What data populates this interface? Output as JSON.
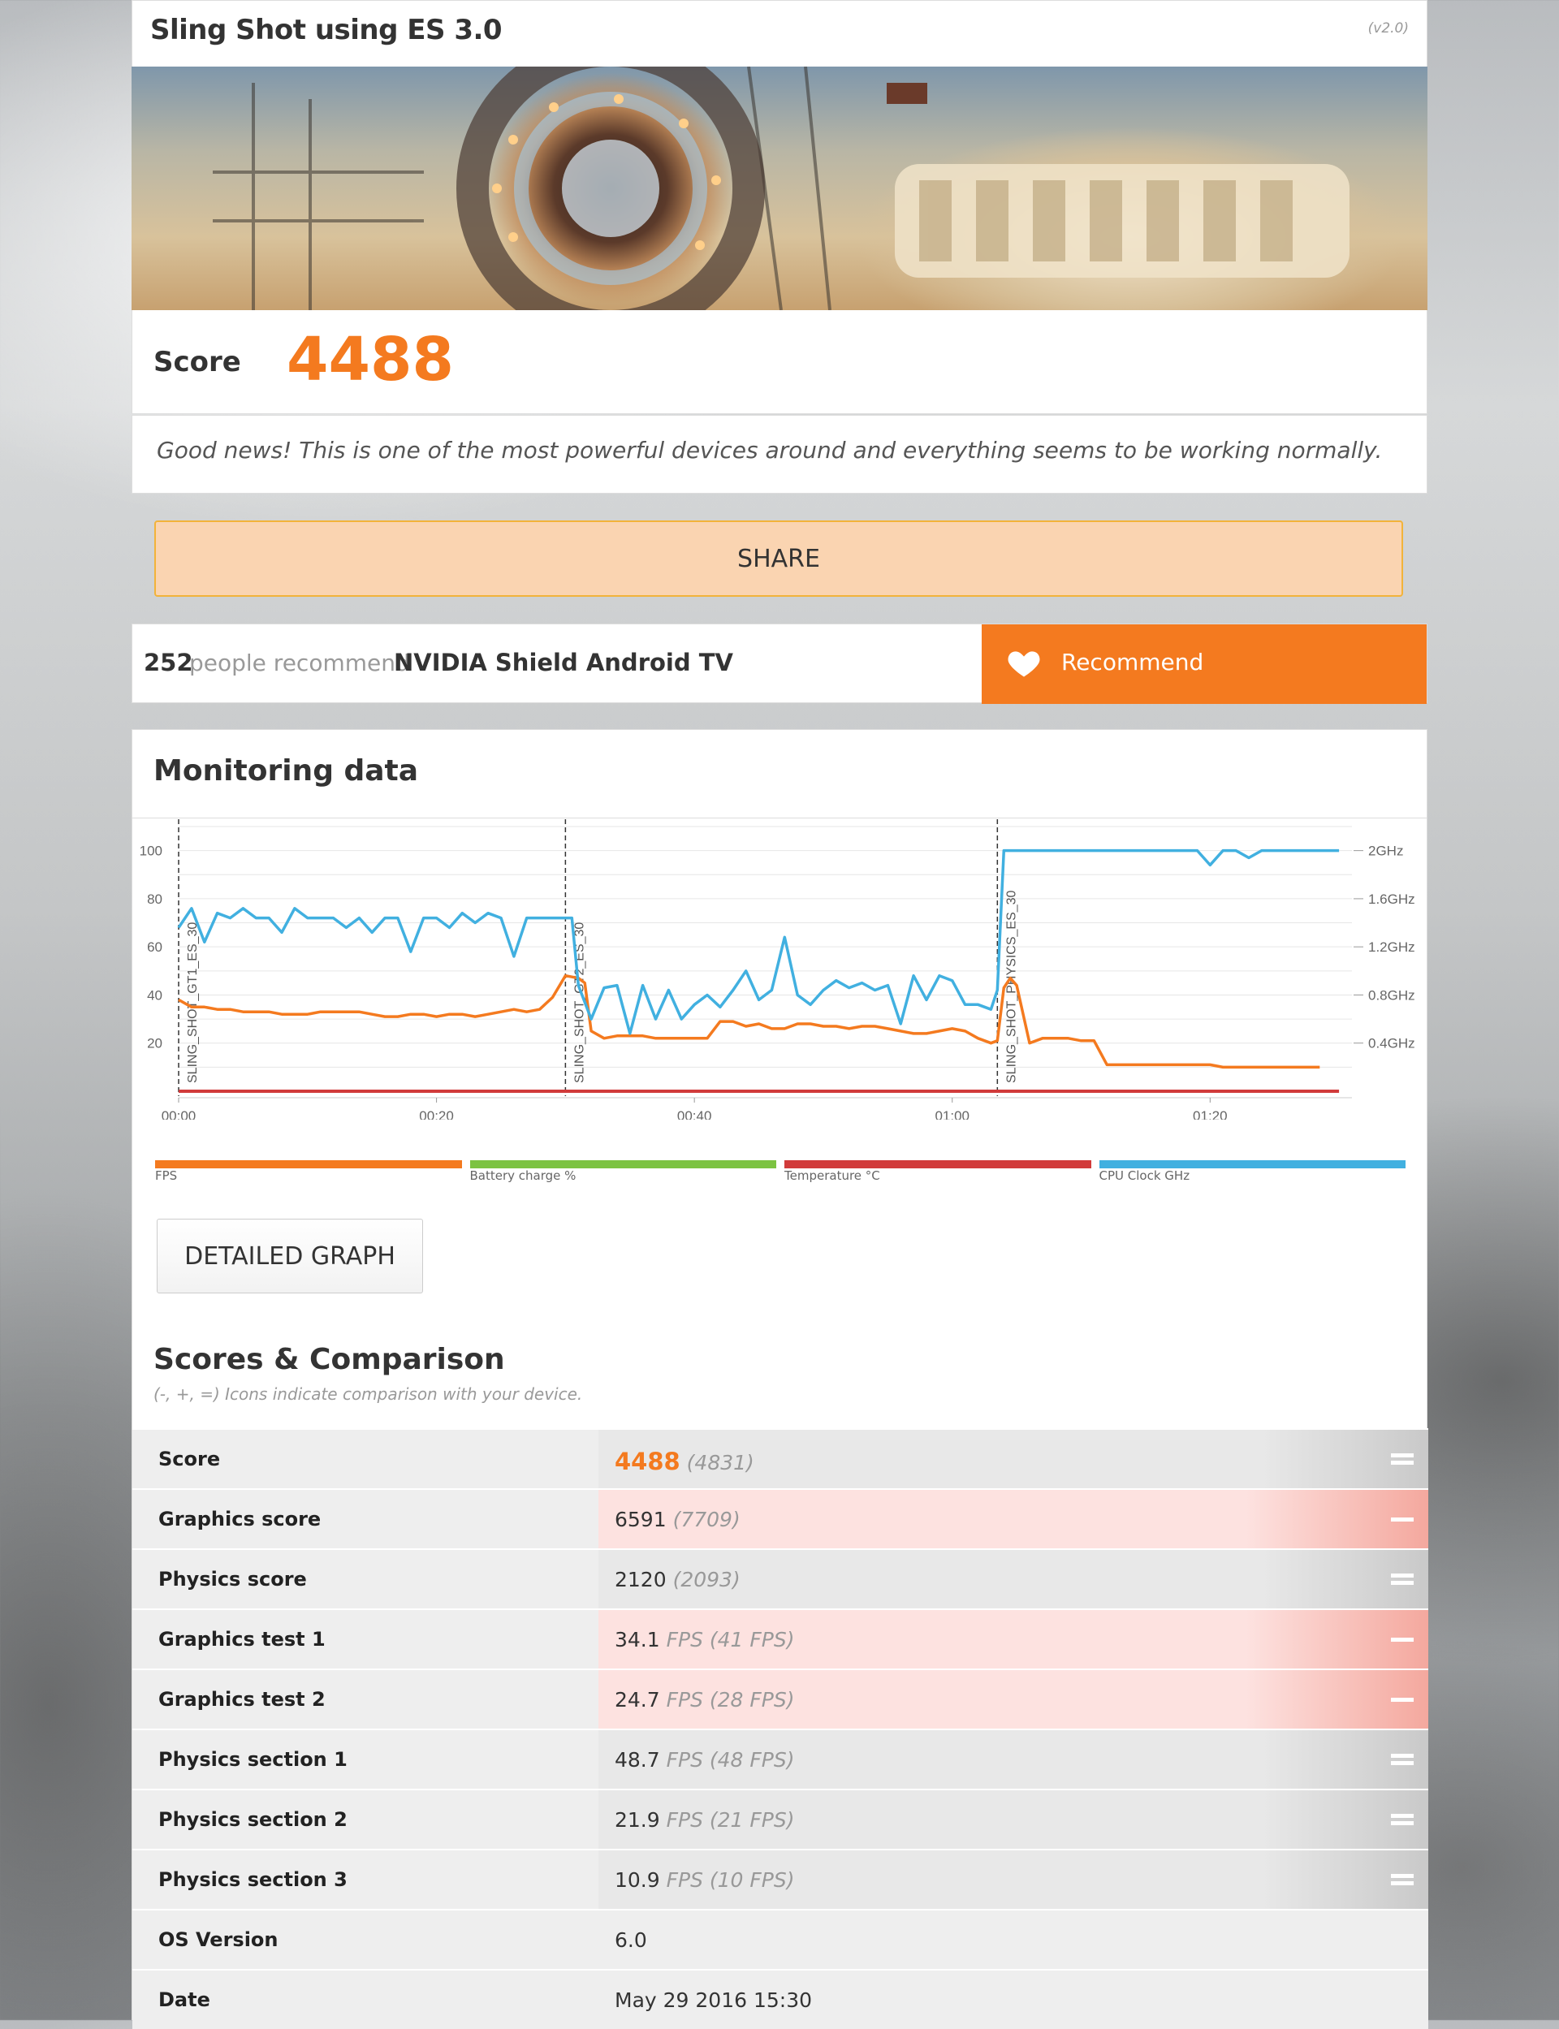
{
  "header": {
    "title": "Sling Shot using ES 3.0",
    "version": "(v2.0)"
  },
  "score": {
    "label": "Score",
    "value": "4488"
  },
  "message": "Good news! This is one of the most powerful devices around and everything seems to be working normally.",
  "share_label": "SHARE",
  "recommend": {
    "count": "252",
    "text": "people recommend",
    "device": "NVIDIA Shield Android TV",
    "button_label": "Recommend"
  },
  "monitoring": {
    "title": "Monitoring data",
    "detail_button": "DETAILED GRAPH"
  },
  "chart_data": {
    "type": "line",
    "x_ticks": [
      "00:00",
      "00:20",
      "00:40",
      "01:00",
      "01:20"
    ],
    "y_left_ticks": [
      "100",
      "80",
      "60",
      "40",
      "20"
    ],
    "y_right_ticks": [
      "2GHz",
      "1.6GHz",
      "1.2GHz",
      "0.8GHz",
      "0.4GHz"
    ],
    "ylim": [
      0,
      110
    ],
    "xlim_seconds": [
      0,
      91
    ],
    "markers": [
      {
        "label": "SLING_SHOT_GT1_ES_30",
        "t": 0
      },
      {
        "label": "SLING_SHOT_GT2_ES_30",
        "t": 30
      },
      {
        "label": "SLING_SHOT_PHYSICS_ES_30",
        "t": 63.5
      }
    ],
    "series": [
      {
        "name": "FPS",
        "color": "#f47a1f",
        "points": [
          [
            0,
            38
          ],
          [
            1,
            35
          ],
          [
            2,
            35
          ],
          [
            3,
            34
          ],
          [
            4,
            34
          ],
          [
            5,
            33
          ],
          [
            6,
            33
          ],
          [
            7,
            33
          ],
          [
            8,
            32
          ],
          [
            9,
            32
          ],
          [
            10,
            32
          ],
          [
            11,
            33
          ],
          [
            12,
            33
          ],
          [
            13,
            33
          ],
          [
            14,
            33
          ],
          [
            15,
            32
          ],
          [
            16,
            31
          ],
          [
            17,
            31
          ],
          [
            18,
            32
          ],
          [
            19,
            32
          ],
          [
            20,
            31
          ],
          [
            21,
            32
          ],
          [
            22,
            32
          ],
          [
            23,
            31
          ],
          [
            24,
            32
          ],
          [
            25,
            33
          ],
          [
            26,
            34
          ],
          [
            27,
            33
          ],
          [
            28,
            34
          ],
          [
            29,
            39
          ],
          [
            30,
            48
          ],
          [
            31,
            47
          ],
          [
            31.5,
            45
          ],
          [
            32,
            25
          ],
          [
            33,
            22
          ],
          [
            34,
            23
          ],
          [
            35,
            23
          ],
          [
            36,
            23
          ],
          [
            37,
            22
          ],
          [
            38,
            22
          ],
          [
            39,
            22
          ],
          [
            40,
            22
          ],
          [
            41,
            22
          ],
          [
            42,
            29
          ],
          [
            43,
            29
          ],
          [
            44,
            27
          ],
          [
            45,
            28
          ],
          [
            46,
            26
          ],
          [
            47,
            26
          ],
          [
            48,
            28
          ],
          [
            49,
            28
          ],
          [
            50,
            27
          ],
          [
            51,
            27
          ],
          [
            52,
            26
          ],
          [
            53,
            27
          ],
          [
            54,
            27
          ],
          [
            55,
            26
          ],
          [
            56,
            25
          ],
          [
            57,
            24
          ],
          [
            58,
            24
          ],
          [
            59,
            25
          ],
          [
            60,
            26
          ],
          [
            61,
            25
          ],
          [
            62,
            22
          ],
          [
            63,
            20
          ],
          [
            63.5,
            21
          ],
          [
            64,
            43
          ],
          [
            64.5,
            47
          ],
          [
            65,
            44
          ],
          [
            66,
            20
          ],
          [
            67,
            22
          ],
          [
            68,
            22
          ],
          [
            69,
            22
          ],
          [
            70,
            21
          ],
          [
            71,
            21
          ],
          [
            72,
            11
          ],
          [
            73,
            11
          ],
          [
            74,
            11
          ],
          [
            75,
            11
          ],
          [
            76,
            11
          ],
          [
            77,
            11
          ],
          [
            78,
            11
          ],
          [
            79,
            11
          ],
          [
            80,
            11
          ],
          [
            81,
            10
          ],
          [
            82,
            10
          ],
          [
            83,
            10
          ],
          [
            84,
            10
          ],
          [
            85,
            10
          ],
          [
            86,
            10
          ],
          [
            87,
            10
          ],
          [
            88,
            10
          ],
          [
            88.5,
            10
          ]
        ]
      },
      {
        "name": "Battery charge %",
        "color": "#7cc342",
        "points": []
      },
      {
        "name": "Temperature °C",
        "color": "#d13b3b",
        "points": [
          [
            0,
            0
          ],
          [
            90,
            0
          ]
        ]
      },
      {
        "name": "CPU Clock GHz",
        "color": "#41b0e0",
        "points": [
          [
            0,
            68
          ],
          [
            1,
            76
          ],
          [
            2,
            62
          ],
          [
            3,
            74
          ],
          [
            4,
            72
          ],
          [
            5,
            76
          ],
          [
            6,
            72
          ],
          [
            7,
            72
          ],
          [
            8,
            66
          ],
          [
            9,
            76
          ],
          [
            10,
            72
          ],
          [
            11,
            72
          ],
          [
            12,
            72
          ],
          [
            13,
            68
          ],
          [
            14,
            72
          ],
          [
            15,
            66
          ],
          [
            16,
            72
          ],
          [
            17,
            72
          ],
          [
            18,
            58
          ],
          [
            19,
            72
          ],
          [
            20,
            72
          ],
          [
            21,
            68
          ],
          [
            22,
            74
          ],
          [
            23,
            70
          ],
          [
            24,
            74
          ],
          [
            25,
            72
          ],
          [
            26,
            56
          ],
          [
            27,
            72
          ],
          [
            28,
            72
          ],
          [
            29,
            72
          ],
          [
            30,
            72
          ],
          [
            30.5,
            72
          ],
          [
            31,
            44
          ],
          [
            32,
            30
          ],
          [
            33,
            43
          ],
          [
            34,
            44
          ],
          [
            35,
            24
          ],
          [
            36,
            44
          ],
          [
            37,
            30
          ],
          [
            38,
            42
          ],
          [
            39,
            30
          ],
          [
            40,
            36
          ],
          [
            41,
            40
          ],
          [
            42,
            35
          ],
          [
            43,
            42
          ],
          [
            44,
            50
          ],
          [
            45,
            38
          ],
          [
            46,
            42
          ],
          [
            47,
            64
          ],
          [
            48,
            40
          ],
          [
            49,
            36
          ],
          [
            50,
            42
          ],
          [
            51,
            46
          ],
          [
            52,
            43
          ],
          [
            53,
            45
          ],
          [
            54,
            42
          ],
          [
            55,
            44
          ],
          [
            56,
            28
          ],
          [
            57,
            48
          ],
          [
            58,
            38
          ],
          [
            59,
            48
          ],
          [
            60,
            46
          ],
          [
            61,
            36
          ],
          [
            62,
            36
          ],
          [
            63,
            34
          ],
          [
            63.5,
            42
          ],
          [
            64,
            100
          ],
          [
            65,
            100
          ],
          [
            66,
            100
          ],
          [
            70,
            100
          ],
          [
            75,
            100
          ],
          [
            79,
            100
          ],
          [
            80,
            94
          ],
          [
            81,
            100
          ],
          [
            82,
            100
          ],
          [
            83,
            97
          ],
          [
            84,
            100
          ],
          [
            85,
            100
          ],
          [
            86,
            100
          ],
          [
            88,
            100
          ],
          [
            90,
            100
          ]
        ]
      }
    ]
  },
  "scores": {
    "title": "Scores & Comparison",
    "subtitle": "(-, +, =) Icons indicate comparison with your device.",
    "rows": [
      {
        "label": "Score",
        "value": "4488",
        "compare": "(4831)",
        "unit": "",
        "style": "gray",
        "icon": "equal-icon"
      },
      {
        "label": "Graphics score",
        "value": "6591",
        "compare": "(7709)",
        "unit": "",
        "style": "red",
        "icon": "minus-icon"
      },
      {
        "label": "Physics score",
        "value": "2120",
        "compare": "(2093)",
        "unit": "",
        "style": "gray",
        "icon": "equal-icon"
      },
      {
        "label": "Graphics test 1",
        "value": "34.1",
        "compare": "FPS (41 FPS)",
        "unit": "",
        "style": "red",
        "icon": "minus-icon"
      },
      {
        "label": "Graphics test 2",
        "value": "24.7",
        "compare": "FPS (28 FPS)",
        "unit": "",
        "style": "red",
        "icon": "minus-icon"
      },
      {
        "label": "Physics section 1",
        "value": "48.7",
        "compare": "FPS (48 FPS)",
        "unit": "",
        "style": "gray",
        "icon": "equal-icon"
      },
      {
        "label": "Physics section 2",
        "value": "21.9",
        "compare": "FPS (21 FPS)",
        "unit": "",
        "style": "gray",
        "icon": "equal-icon"
      },
      {
        "label": "Physics section 3",
        "value": "10.9",
        "compare": "FPS (10 FPS)",
        "unit": "",
        "style": "gray",
        "icon": "equal-icon"
      },
      {
        "label": "OS Version",
        "value": "6.0",
        "compare": "",
        "unit": "",
        "style": "plain",
        "icon": ""
      },
      {
        "label": "Date",
        "value": "May 29 2016 15:30",
        "compare": "",
        "unit": "",
        "style": "plain",
        "icon": ""
      }
    ]
  }
}
